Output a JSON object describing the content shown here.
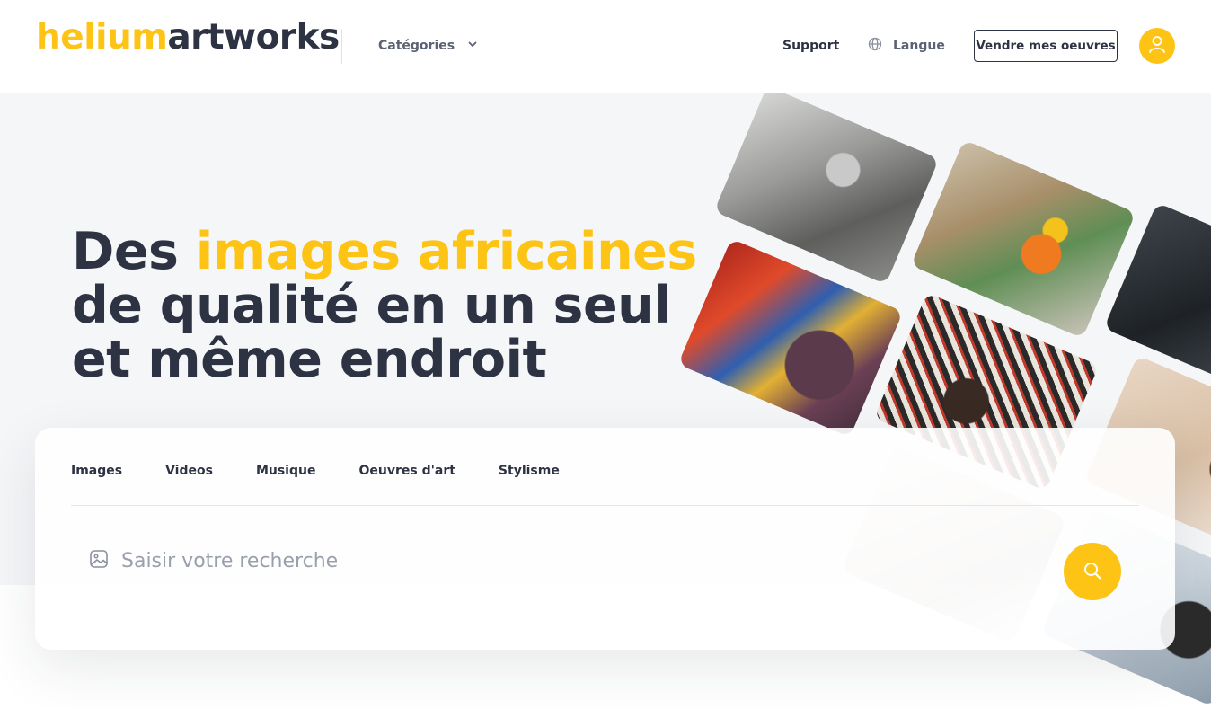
{
  "header": {
    "logo_part1": "helium",
    "logo_part2": "artworks",
    "categories_label": "Catégories",
    "support_label": "Support",
    "langue_label": "Langue",
    "sell_button_label": "Vendre mes oeuvres"
  },
  "hero": {
    "title_part1": "Des ",
    "title_highlight": "images africaines",
    "title_part2": " de qualité en un seul et même endroit"
  },
  "search": {
    "tabs": [
      {
        "label": "Images"
      },
      {
        "label": "Videos"
      },
      {
        "label": "Musique"
      },
      {
        "label": "Oeuvres d'art"
      },
      {
        "label": "Stylisme"
      }
    ],
    "placeholder": "Saisir votre recherche"
  },
  "icons": {
    "categories": "chevron-down-icon",
    "langue": "globe-icon",
    "avatar": "user-icon",
    "search_field": "image-icon",
    "search_button": "search-icon"
  },
  "colors": {
    "accent": "#fdc315",
    "text_dark": "#2d3342",
    "hero_background": "#f5f6f8"
  }
}
